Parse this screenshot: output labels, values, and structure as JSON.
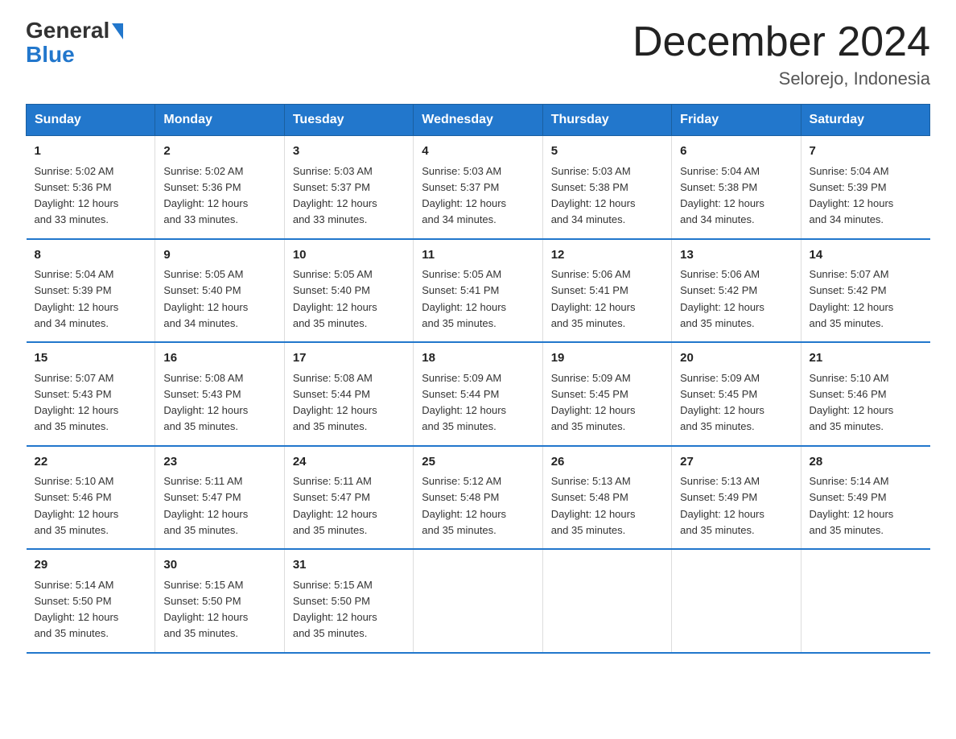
{
  "header": {
    "logo_general": "General",
    "logo_blue": "Blue",
    "month_title": "December 2024",
    "location": "Selorejo, Indonesia"
  },
  "days_of_week": [
    "Sunday",
    "Monday",
    "Tuesday",
    "Wednesday",
    "Thursday",
    "Friday",
    "Saturday"
  ],
  "weeks": [
    [
      {
        "day": "1",
        "sunrise": "5:02 AM",
        "sunset": "5:36 PM",
        "daylight": "12 hours and 33 minutes."
      },
      {
        "day": "2",
        "sunrise": "5:02 AM",
        "sunset": "5:36 PM",
        "daylight": "12 hours and 33 minutes."
      },
      {
        "day": "3",
        "sunrise": "5:03 AM",
        "sunset": "5:37 PM",
        "daylight": "12 hours and 33 minutes."
      },
      {
        "day": "4",
        "sunrise": "5:03 AM",
        "sunset": "5:37 PM",
        "daylight": "12 hours and 34 minutes."
      },
      {
        "day": "5",
        "sunrise": "5:03 AM",
        "sunset": "5:38 PM",
        "daylight": "12 hours and 34 minutes."
      },
      {
        "day": "6",
        "sunrise": "5:04 AM",
        "sunset": "5:38 PM",
        "daylight": "12 hours and 34 minutes."
      },
      {
        "day": "7",
        "sunrise": "5:04 AM",
        "sunset": "5:39 PM",
        "daylight": "12 hours and 34 minutes."
      }
    ],
    [
      {
        "day": "8",
        "sunrise": "5:04 AM",
        "sunset": "5:39 PM",
        "daylight": "12 hours and 34 minutes."
      },
      {
        "day": "9",
        "sunrise": "5:05 AM",
        "sunset": "5:40 PM",
        "daylight": "12 hours and 34 minutes."
      },
      {
        "day": "10",
        "sunrise": "5:05 AM",
        "sunset": "5:40 PM",
        "daylight": "12 hours and 35 minutes."
      },
      {
        "day": "11",
        "sunrise": "5:05 AM",
        "sunset": "5:41 PM",
        "daylight": "12 hours and 35 minutes."
      },
      {
        "day": "12",
        "sunrise": "5:06 AM",
        "sunset": "5:41 PM",
        "daylight": "12 hours and 35 minutes."
      },
      {
        "day": "13",
        "sunrise": "5:06 AM",
        "sunset": "5:42 PM",
        "daylight": "12 hours and 35 minutes."
      },
      {
        "day": "14",
        "sunrise": "5:07 AM",
        "sunset": "5:42 PM",
        "daylight": "12 hours and 35 minutes."
      }
    ],
    [
      {
        "day": "15",
        "sunrise": "5:07 AM",
        "sunset": "5:43 PM",
        "daylight": "12 hours and 35 minutes."
      },
      {
        "day": "16",
        "sunrise": "5:08 AM",
        "sunset": "5:43 PM",
        "daylight": "12 hours and 35 minutes."
      },
      {
        "day": "17",
        "sunrise": "5:08 AM",
        "sunset": "5:44 PM",
        "daylight": "12 hours and 35 minutes."
      },
      {
        "day": "18",
        "sunrise": "5:09 AM",
        "sunset": "5:44 PM",
        "daylight": "12 hours and 35 minutes."
      },
      {
        "day": "19",
        "sunrise": "5:09 AM",
        "sunset": "5:45 PM",
        "daylight": "12 hours and 35 minutes."
      },
      {
        "day": "20",
        "sunrise": "5:09 AM",
        "sunset": "5:45 PM",
        "daylight": "12 hours and 35 minutes."
      },
      {
        "day": "21",
        "sunrise": "5:10 AM",
        "sunset": "5:46 PM",
        "daylight": "12 hours and 35 minutes."
      }
    ],
    [
      {
        "day": "22",
        "sunrise": "5:10 AM",
        "sunset": "5:46 PM",
        "daylight": "12 hours and 35 minutes."
      },
      {
        "day": "23",
        "sunrise": "5:11 AM",
        "sunset": "5:47 PM",
        "daylight": "12 hours and 35 minutes."
      },
      {
        "day": "24",
        "sunrise": "5:11 AM",
        "sunset": "5:47 PM",
        "daylight": "12 hours and 35 minutes."
      },
      {
        "day": "25",
        "sunrise": "5:12 AM",
        "sunset": "5:48 PM",
        "daylight": "12 hours and 35 minutes."
      },
      {
        "day": "26",
        "sunrise": "5:13 AM",
        "sunset": "5:48 PM",
        "daylight": "12 hours and 35 minutes."
      },
      {
        "day": "27",
        "sunrise": "5:13 AM",
        "sunset": "5:49 PM",
        "daylight": "12 hours and 35 minutes."
      },
      {
        "day": "28",
        "sunrise": "5:14 AM",
        "sunset": "5:49 PM",
        "daylight": "12 hours and 35 minutes."
      }
    ],
    [
      {
        "day": "29",
        "sunrise": "5:14 AM",
        "sunset": "5:50 PM",
        "daylight": "12 hours and 35 minutes."
      },
      {
        "day": "30",
        "sunrise": "5:15 AM",
        "sunset": "5:50 PM",
        "daylight": "12 hours and 35 minutes."
      },
      {
        "day": "31",
        "sunrise": "5:15 AM",
        "sunset": "5:50 PM",
        "daylight": "12 hours and 35 minutes."
      },
      null,
      null,
      null,
      null
    ]
  ],
  "labels": {
    "sunrise": "Sunrise:",
    "sunset": "Sunset:",
    "daylight": "Daylight:"
  }
}
